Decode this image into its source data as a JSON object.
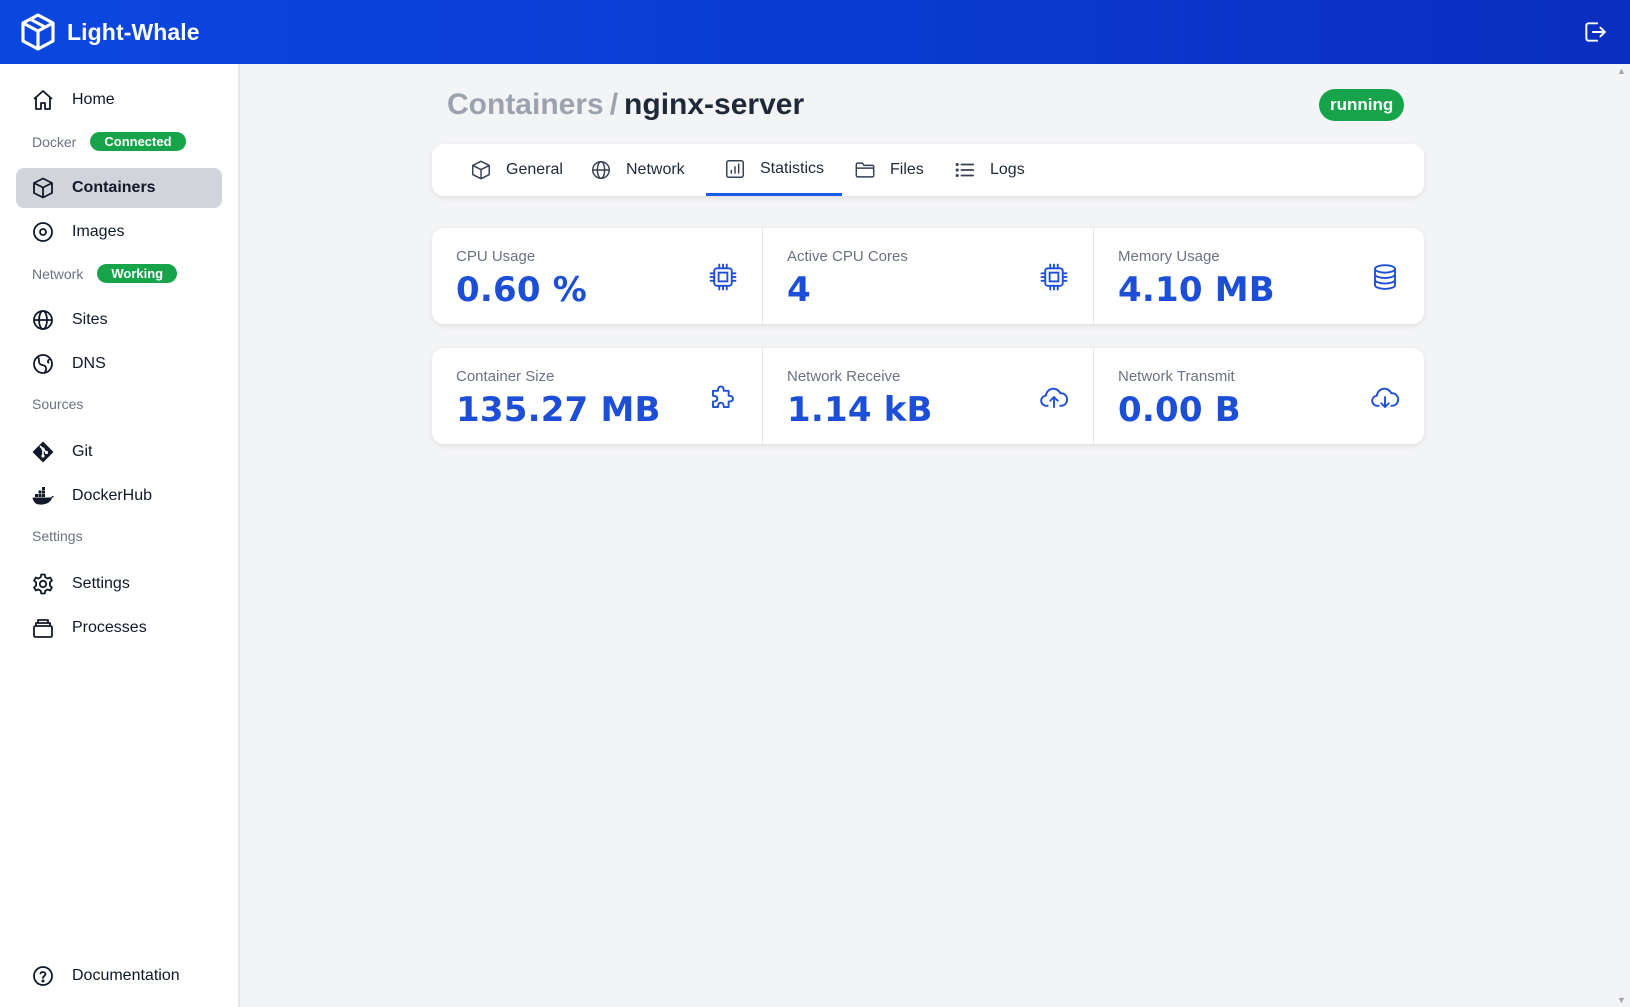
{
  "app": {
    "name": "Light-Whale"
  },
  "sidebar": {
    "home": "Home",
    "docker_section": "Docker",
    "docker_status": "Connected",
    "containers": "Containers",
    "images": "Images",
    "network_section": "Network",
    "network_status": "Working",
    "sites": "Sites",
    "dns": "DNS",
    "sources_section": "Sources",
    "git": "Git",
    "dockerhub": "DockerHub",
    "settings_section": "Settings",
    "settings": "Settings",
    "processes": "Processes",
    "documentation": "Documentation"
  },
  "header": {
    "breadcrumb_parent": "Containers",
    "breadcrumb_sep": "/",
    "container_name": "nginx-server",
    "status": "running"
  },
  "tabs": [
    {
      "label": "General",
      "icon": "cube-icon"
    },
    {
      "label": "Network",
      "icon": "globe-icon"
    },
    {
      "label": "Statistics",
      "icon": "chart-icon",
      "active": true
    },
    {
      "label": "Files",
      "icon": "folder-icon"
    },
    {
      "label": "Logs",
      "icon": "list-icon"
    }
  ],
  "stats": [
    {
      "label": "CPU Usage",
      "value": "0.60 %",
      "icon": "cpu-chip-icon"
    },
    {
      "label": "Active CPU Cores",
      "value": "4",
      "icon": "cpu-chip-icon"
    },
    {
      "label": "Memory Usage",
      "value": "4.10 MB",
      "icon": "database-icon"
    },
    {
      "label": "Container Size",
      "value": "135.27 MB",
      "icon": "puzzle-icon"
    },
    {
      "label": "Network Receive",
      "value": "1.14 kB",
      "icon": "cloud-upload-icon"
    },
    {
      "label": "Network Transmit",
      "value": "0.00 B",
      "icon": "cloud-download-icon"
    }
  ],
  "colors": {
    "accent": "#1d4ed8",
    "topbar": "#0b47df",
    "success": "#16a34a"
  }
}
